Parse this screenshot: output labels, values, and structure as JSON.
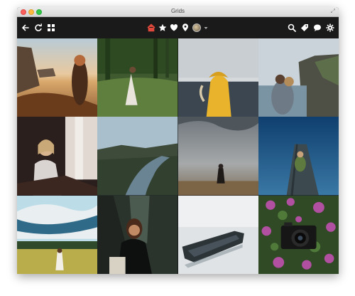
{
  "window": {
    "title": "Grids"
  },
  "toolbar": {
    "left_icons": [
      "back-arrow-icon",
      "refresh-icon",
      "grid-view-icon"
    ],
    "center_icons": [
      "home-icon",
      "star-icon",
      "heart-icon",
      "location-pin-icon",
      "profile-avatar-icon",
      "chevron-down-icon"
    ],
    "right_icons": [
      "search-icon",
      "tag-icon",
      "message-icon",
      "gear-icon"
    ]
  },
  "colors": {
    "titlebar": "#dcdcdc",
    "toolbar": "#1a1a1a",
    "accent_red": "#e0483c"
  }
}
